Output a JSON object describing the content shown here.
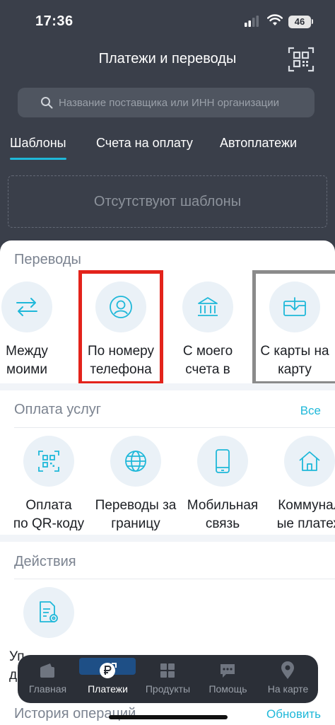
{
  "status_bar": {
    "time": "17:36",
    "battery": "46"
  },
  "header": {
    "title": "Платежи и переводы"
  },
  "search": {
    "placeholder": "Название поставщика или ИНН организации"
  },
  "tabs": [
    {
      "label": "Шаблоны",
      "active": true
    },
    {
      "label": "Счета на оплату",
      "active": false
    },
    {
      "label": "Автоплатежи",
      "active": false
    }
  ],
  "templates_empty_text": "Отсутствуют шаблоны",
  "transfers": {
    "title": "Переводы",
    "items": [
      {
        "label": "Между\nмоими",
        "icon": "arrows-swap-icon"
      },
      {
        "label": "По номеру\nтелефона",
        "icon": "person-icon"
      },
      {
        "label": "С моего\nсчета в",
        "icon": "bank-icon"
      },
      {
        "label": "С карты на\nкарту",
        "icon": "card-transfer-icon"
      }
    ]
  },
  "services": {
    "title": "Оплата услуг",
    "all_label": "Все",
    "items": [
      {
        "label": "Оплата\nпо QR-коду",
        "icon": "qr-icon"
      },
      {
        "label": "Переводы за\nграницу",
        "icon": "globe-icon"
      },
      {
        "label": "Мобильная\nсвязь",
        "icon": "phone-icon"
      },
      {
        "label": "Коммунал\nые платеж",
        "icon": "house-icon"
      }
    ]
  },
  "actions": {
    "title": "Действия",
    "items": [
      {
        "label": "Уп\nд",
        "icon": "document-settings-icon"
      }
    ]
  },
  "history": {
    "title": "История операций",
    "refresh_label": "Обновить"
  },
  "bottom_nav": [
    {
      "label": "Главная",
      "icon": "wallet-icon",
      "active": false
    },
    {
      "label": "Платежи",
      "icon": "payment-icon",
      "active": true
    },
    {
      "label": "Продукты",
      "icon": "grid-icon",
      "active": false
    },
    {
      "label": "Помощь",
      "icon": "chat-icon",
      "active": false
    },
    {
      "label": "На карте",
      "icon": "map-pin-icon",
      "active": false
    }
  ],
  "colors": {
    "accent": "#1fb8d9",
    "dark_bg": "#3a3f4a",
    "highlight_red": "#e3231b",
    "highlight_gray": "#8b8b8b"
  }
}
